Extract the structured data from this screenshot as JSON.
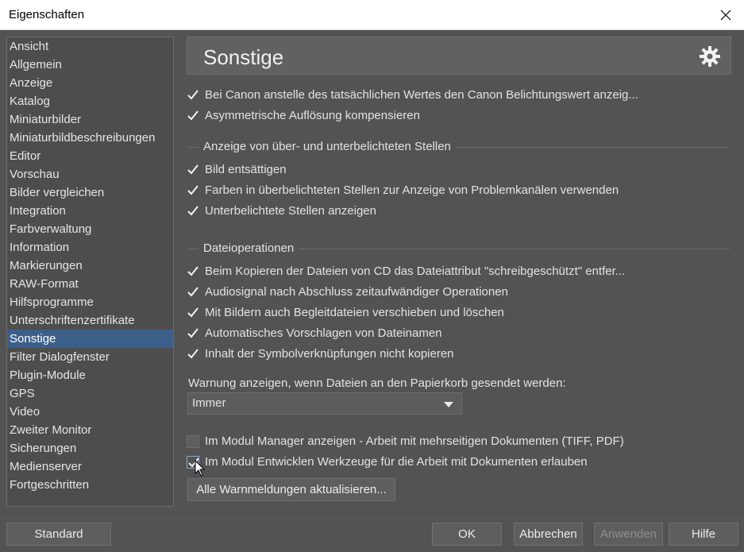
{
  "window": {
    "title": "Eigenschaften"
  },
  "sidebar": {
    "items": [
      {
        "label": "Ansicht"
      },
      {
        "label": "Allgemein"
      },
      {
        "label": "Anzeige"
      },
      {
        "label": "Katalog"
      },
      {
        "label": "Miniaturbilder"
      },
      {
        "label": "Miniaturbildbeschreibungen"
      },
      {
        "label": "Editor"
      },
      {
        "label": "Vorschau"
      },
      {
        "label": "Bilder vergleichen"
      },
      {
        "label": "Integration"
      },
      {
        "label": "Farbverwaltung"
      },
      {
        "label": "Information"
      },
      {
        "label": "Markierungen"
      },
      {
        "label": "RAW-Format"
      },
      {
        "label": "Hilfsprogramme"
      },
      {
        "label": "Unterschriftenzertifikate"
      },
      {
        "label": "Sonstige",
        "selected": true
      },
      {
        "label": "Filter Dialogfenster"
      },
      {
        "label": "Plugin-Module"
      },
      {
        "label": "GPS"
      },
      {
        "label": "Video"
      },
      {
        "label": "Zweiter Monitor"
      },
      {
        "label": "Sicherungen"
      },
      {
        "label": "Medienserver"
      },
      {
        "label": "Fortgeschritten"
      }
    ]
  },
  "panel": {
    "title": "Sonstige",
    "icon": "gear-icon",
    "checkbox_canon": {
      "label": "Bei Canon anstelle des tatsächlichen Wertes den Canon Belichtungswert anzeig...",
      "checked": true
    },
    "checkbox_asym": {
      "label": "Asymmetrische Auflösung kompensieren",
      "checked": true
    },
    "group_exposure": {
      "label": "Anzeige von über- und unterbelichteten Stellen"
    },
    "checkbox_desat": {
      "label": "Bild entsättigen",
      "checked": true
    },
    "checkbox_colors": {
      "label": "Farben in überbelichteten Stellen zur Anzeige von Problemkanälen verwenden",
      "checked": true
    },
    "checkbox_under": {
      "label": "Unterbelichtete Stellen anzeigen",
      "checked": true
    },
    "group_fileops": {
      "label": "Dateioperationen"
    },
    "checkbox_copycd": {
      "label": "Beim Kopieren der Dateien von CD das Dateiattribut \"schreibgeschützt\" entfer...",
      "checked": true
    },
    "checkbox_audio": {
      "label": "Audiosignal nach Abschluss zeitaufwändiger Operationen",
      "checked": true
    },
    "checkbox_sidecar": {
      "label": "Mit Bildern auch Begleitdateien verschieben und löschen",
      "checked": true
    },
    "checkbox_autoname": {
      "label": "Automatisches Vorschlagen von Dateinamen",
      "checked": true
    },
    "checkbox_symlink": {
      "label": "Inhalt der Symbolverknüpfungen nicht kopieren",
      "checked": true
    },
    "recycle_warning_label": "Warnung anzeigen, wenn Dateien an den Papierkorb gesendet werden:",
    "recycle_warning_value": "Immer",
    "checkbox_manager": {
      "label": "Im Modul Manager anzeigen - Arbeit mit mehrseitigen Dokumenten (TIFF, PDF)",
      "checked": false
    },
    "checkbox_develop": {
      "label": "Im Modul Entwicklen Werkzeuge für die Arbeit mit Dokumenten erlauben",
      "checked": true
    },
    "refresh_warnings_button": "Alle Warnmeldungen aktualisieren..."
  },
  "footer": {
    "standard": "Standard",
    "ok": "OK",
    "cancel": "Abbrechen",
    "apply": "Anwenden",
    "help": "Hilfe"
  },
  "colors": {
    "background": "#535353",
    "selection": "#3c5f8a",
    "text": "#e3e3e3",
    "disabled_text": "#8f8f8f"
  }
}
